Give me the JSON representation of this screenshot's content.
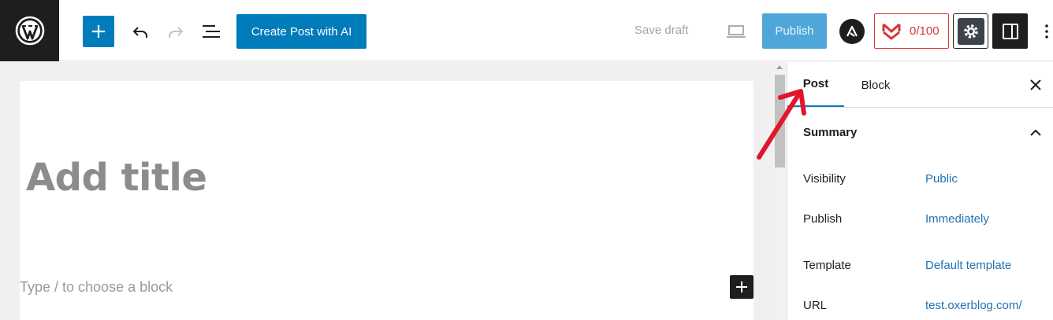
{
  "toolbar": {
    "create_ai_label": "Create Post with AI",
    "save_draft_label": "Save draft",
    "publish_label": "Publish",
    "score_label": "0/100"
  },
  "editor": {
    "title_placeholder": "Add title",
    "block_placeholder": "Type / to choose a block"
  },
  "sidebar": {
    "tabs": [
      {
        "label": "Post",
        "active": true
      },
      {
        "label": "Block",
        "active": false
      }
    ],
    "summary_label": "Summary",
    "rows": [
      {
        "label": "Visibility",
        "value": "Public"
      },
      {
        "label": "Publish",
        "value": "Immediately"
      },
      {
        "label": "Template",
        "value": "Default template"
      },
      {
        "label": "URL",
        "value": "test.oxerblog.com/"
      }
    ]
  },
  "colors": {
    "accent": "#007cba",
    "publish_disabled": "#4fa6d9",
    "score_red": "#d63638",
    "link_blue": "#2271b1",
    "annotation_arrow": "#e0162b"
  },
  "icons": [
    "wordpress-logo-icon",
    "plus-icon",
    "undo-icon",
    "redo-icon",
    "list-view-icon",
    "desktop-preview-icon",
    "astra-icon",
    "seo-score-icon",
    "gear-icon",
    "sidebar-panel-icon",
    "more-vertical-icon",
    "close-icon",
    "chevron-up-icon"
  ]
}
